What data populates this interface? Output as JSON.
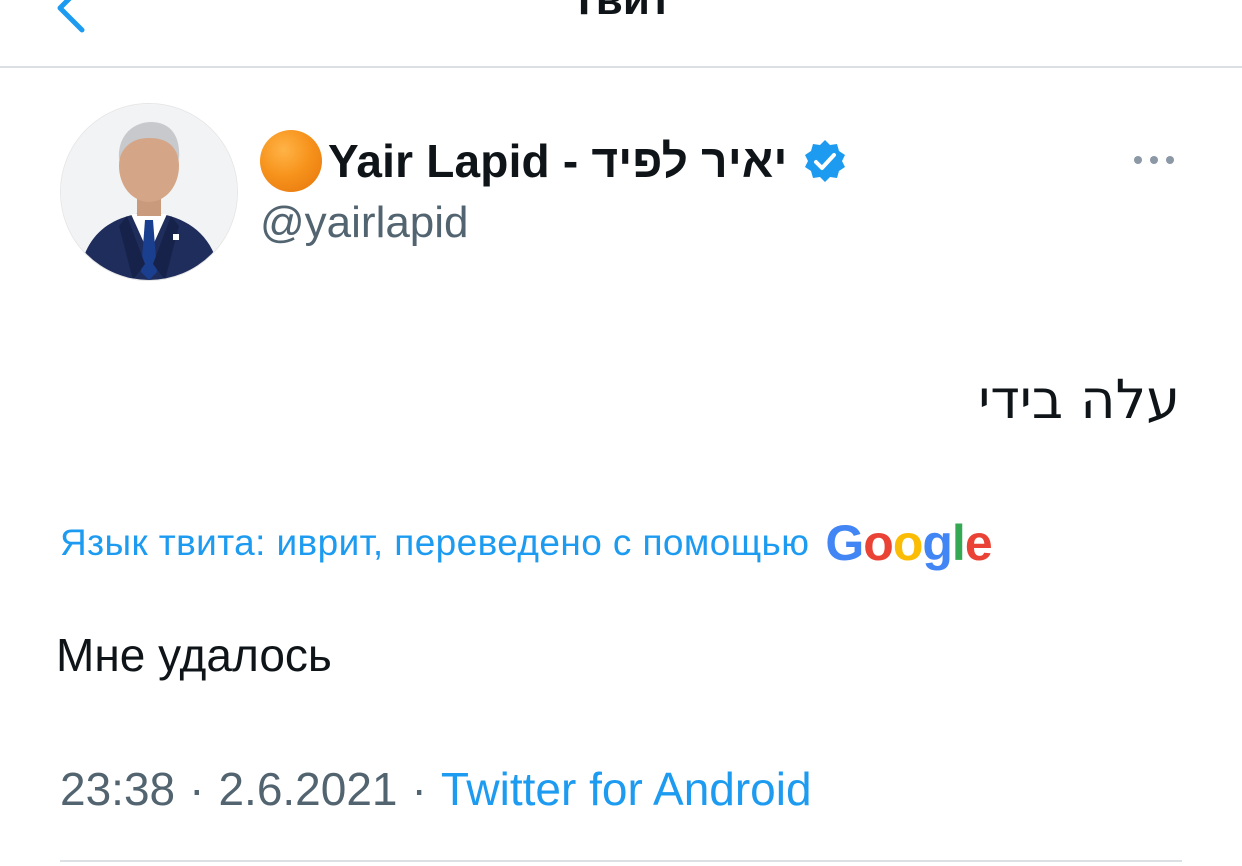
{
  "header": {
    "title": "Твит",
    "back_icon": "chevron-left-icon"
  },
  "author": {
    "emoji": "orange-circle",
    "name": "Yair Lapid - יאיר לפיד",
    "handle": "@yairlapid",
    "verified": true,
    "verified_color": "#1d9bf0"
  },
  "tweet": {
    "original_text": "עלה בידי",
    "translation_label": "Язык твита: иврит, переведено с помощью",
    "translation_provider": "Google",
    "translated_text": "Мне удалось"
  },
  "meta": {
    "time": "23:38",
    "separator": "·",
    "date": "2.6.2021",
    "source": "Twitter for Android"
  },
  "colors": {
    "accent": "#1d9bf0",
    "text": "#0f1419",
    "secondary": "#536471"
  }
}
